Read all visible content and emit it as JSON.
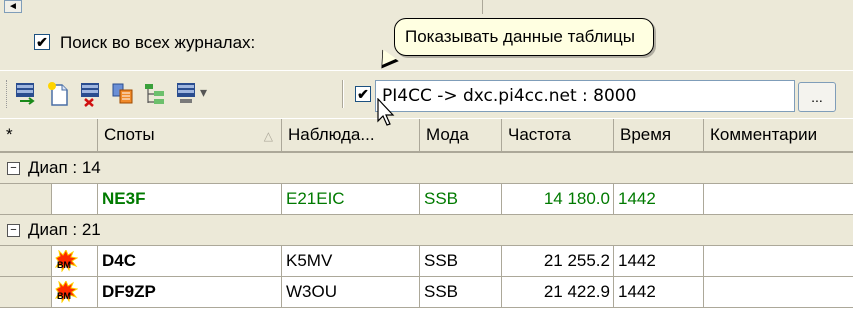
{
  "top": {
    "scroll_arrow": "◄"
  },
  "search": {
    "checked": "✔",
    "label": "Поиск во всех журналах:"
  },
  "tooltip": {
    "text": "Показывать данные таблицы"
  },
  "toolbar": {
    "icons": [
      "telnet-send-icon",
      "new-file-icon",
      "telnet-disconnect-icon",
      "filter-icon",
      "tree-view-icon",
      "telnet-menu-icon"
    ],
    "dropdown_glyph": "▾",
    "cluster_checked": "✔",
    "cluster_text": "PI4CC -> dxc.pi4cc.net : 8000",
    "browse_label": "..."
  },
  "columns": [
    "*",
    "Споты",
    "Наблюдатель",
    "Мода",
    "Частота",
    "Время",
    "Комментарии"
  ],
  "columns_display": [
    "*",
    "Споты",
    "Наблюда...",
    "Мода",
    "Частота",
    "Время",
    "Комментарии"
  ],
  "groups": [
    {
      "toggle": "−",
      "label": "Диап : 14",
      "rows": [
        {
          "spot": "NE3F",
          "observer": "E21EIC",
          "mode": "SSB",
          "freq": "14 180.0",
          "time": "1442",
          "comment": "",
          "new": true
        }
      ]
    },
    {
      "toggle": "−",
      "label": "Диап : 21",
      "rows": [
        {
          "spot": "D4C",
          "observer": "K5MV",
          "mode": "SSB",
          "freq": "21 255.2",
          "time": "1442",
          "comment": "",
          "new": false,
          "icon": "bm"
        },
        {
          "spot": "DF9ZP",
          "observer": "W3OU",
          "mode": "SSB",
          "freq": "21 422.9",
          "time": "1442",
          "comment": "",
          "new": false,
          "icon": "bm"
        }
      ]
    }
  ],
  "bm_icon_text": "BM",
  "colors": {
    "new_spot": "#007a00",
    "toolbar_bg": "#ece9d8",
    "tooltip_bg": "#ffffe1"
  }
}
